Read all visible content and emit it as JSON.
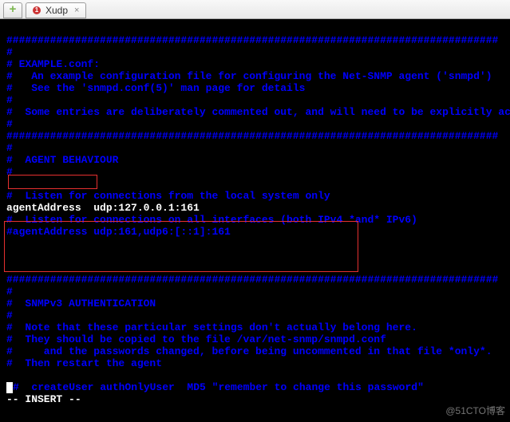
{
  "tabs": {
    "new_label": "+",
    "tab1": {
      "number": "1",
      "title": "Xudp",
      "close": "×"
    }
  },
  "lines": {
    "l0": "###############################################################################",
    "l1": "#",
    "l2": "# EXAMPLE.conf:",
    "l3": "#   An example configuration file for configuring the Net-SNMP agent ('snmpd')",
    "l4": "#   See the 'snmpd.conf(5)' man page for details",
    "l5": "#",
    "l6": "#  Some entries are deliberately commented out, and will need to be explicitly activated",
    "l7": "#",
    "l8": "###############################################################################",
    "l9": "#",
    "l10": "#  AGENT BEHAVIOUR",
    "l11": "#",
    "l12": "",
    "l13": "#  Listen for connections from the local system only",
    "l14": "agentAddress  udp:127.0.0.1:161",
    "l15": "#  Listen for connections on all interfaces (both IPv4 *and* IPv6)",
    "l16": "#agentAddress udp:161,udp6:[::1]:161",
    "l17": "",
    "l18": "",
    "l19": "",
    "l20": "###############################################################################",
    "l21": "#",
    "l22": "#  SNMPv3 AUTHENTICATION",
    "l23": "#",
    "l24": "#  Note that these particular settings don't actually belong here.",
    "l25": "#  They should be copied to the file /var/net-snmp/snmpd.conf",
    "l26": "#     and the passwords changed, before being uncommented in that file *only*.",
    "l27": "#  Then restart the agent",
    "l28": "",
    "l29": "#  createUser authOnlyUser  MD5 \"remember to change this password\"",
    "status": "-- INSERT --"
  },
  "watermark": "@51CTO博客"
}
